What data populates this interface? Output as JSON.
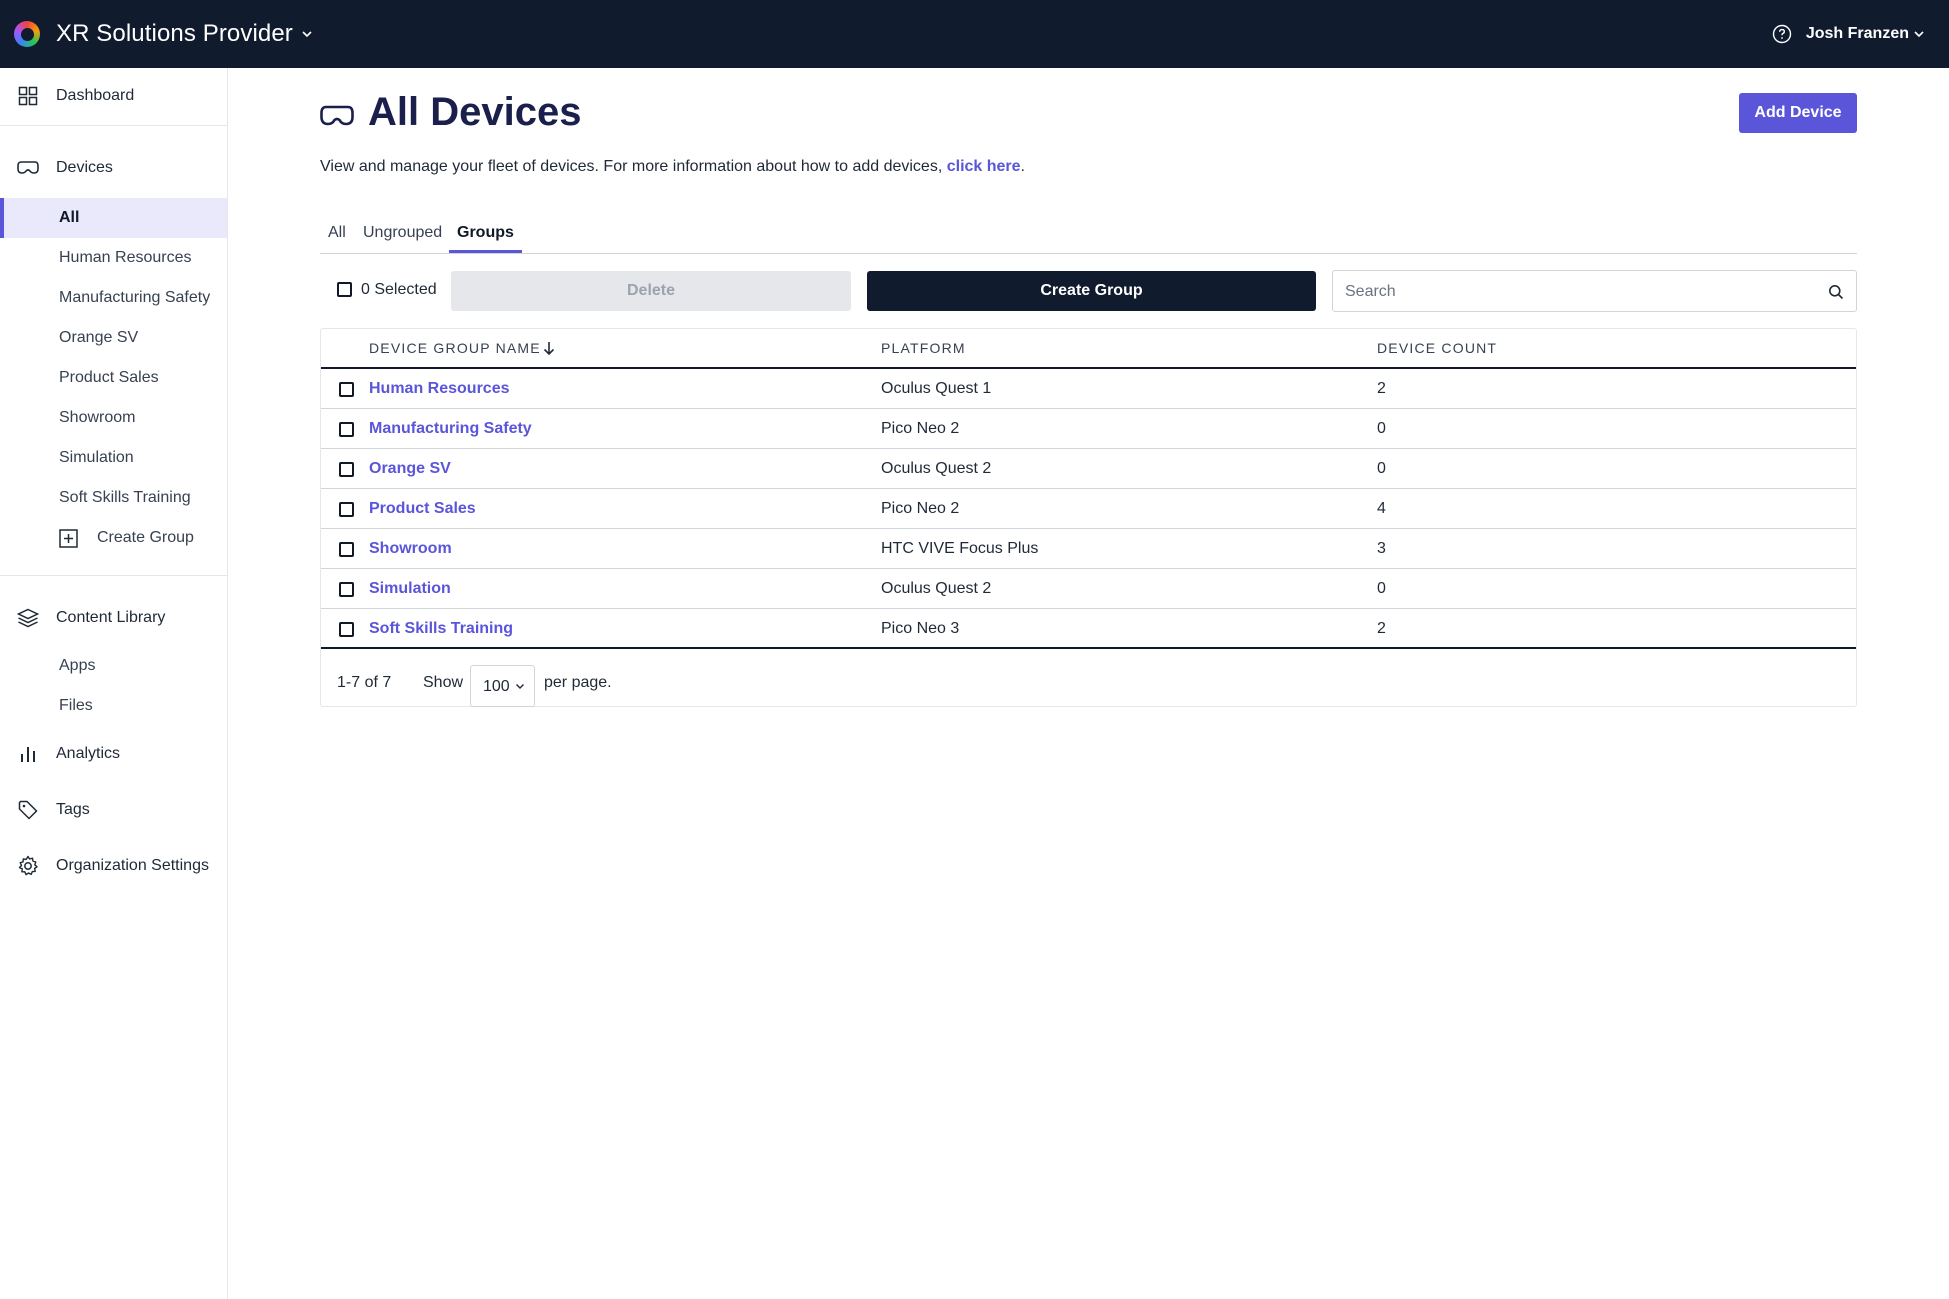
{
  "header": {
    "org_name": "XR Solutions Provider",
    "user_name": "Josh Franzen"
  },
  "sidebar": {
    "dashboard": "Dashboard",
    "devices": "Devices",
    "device_groups": [
      {
        "label": "All",
        "active": true
      },
      {
        "label": "Human Resources"
      },
      {
        "label": "Manufacturing Safety"
      },
      {
        "label": "Orange SV"
      },
      {
        "label": "Product Sales"
      },
      {
        "label": "Showroom"
      },
      {
        "label": "Simulation"
      },
      {
        "label": "Soft Skills Training"
      }
    ],
    "create_group": "Create Group",
    "content_library": "Content Library",
    "apps": "Apps",
    "files": "Files",
    "analytics": "Analytics",
    "tags": "Tags",
    "org_settings": "Organization Settings"
  },
  "main": {
    "title": "All Devices",
    "add_device": "Add Device",
    "description": "View and manage your fleet of devices. For more information about how to add devices, ",
    "description_link": "click here",
    "description_end": ".",
    "tabs": [
      {
        "label": "All"
      },
      {
        "label": "Ungrouped"
      },
      {
        "label": "Groups",
        "active": true
      }
    ],
    "selected_label": "0 Selected",
    "delete_label": "Delete",
    "create_group_label": "Create Group",
    "search_placeholder": "Search"
  },
  "table": {
    "columns": [
      "DEVICE GROUP NAME",
      "PLATFORM",
      "DEVICE COUNT"
    ],
    "rows": [
      {
        "name": "Human Resources",
        "platform": "Oculus Quest 1",
        "count": "2"
      },
      {
        "name": "Manufacturing Safety",
        "platform": "Pico Neo 2",
        "count": "0"
      },
      {
        "name": "Orange SV",
        "platform": "Oculus Quest 2",
        "count": "0"
      },
      {
        "name": "Product Sales",
        "platform": "Pico Neo 2",
        "count": "4"
      },
      {
        "name": "Showroom",
        "platform": "HTC VIVE Focus Plus",
        "count": "3"
      },
      {
        "name": "Simulation",
        "platform": "Oculus Quest 2",
        "count": "0"
      },
      {
        "name": "Soft Skills Training",
        "platform": "Pico Neo 3",
        "count": "2"
      }
    ],
    "pagination": {
      "range": "1-7 of 7",
      "show_label": "Show",
      "per_page": "100",
      "per_page_suffix": "per page."
    }
  },
  "colors": {
    "topbar": "#111b2e",
    "accent": "#5a55d9",
    "title": "#1a1f4b",
    "active_nav_bg": "#e9e9fb"
  },
  "icons": {
    "topbar": [
      "logo-icon",
      "chevron-down-icon",
      "help-circle-icon"
    ],
    "sidebar": [
      "grid-icon",
      "vr-headset-icon",
      "plus-square-icon",
      "layers-icon",
      "bar-chart-icon",
      "tag-icon",
      "gear-icon"
    ],
    "main": [
      "vr-headset-icon",
      "search-icon",
      "sort-down-icon",
      "chevron-down-icon"
    ]
  }
}
